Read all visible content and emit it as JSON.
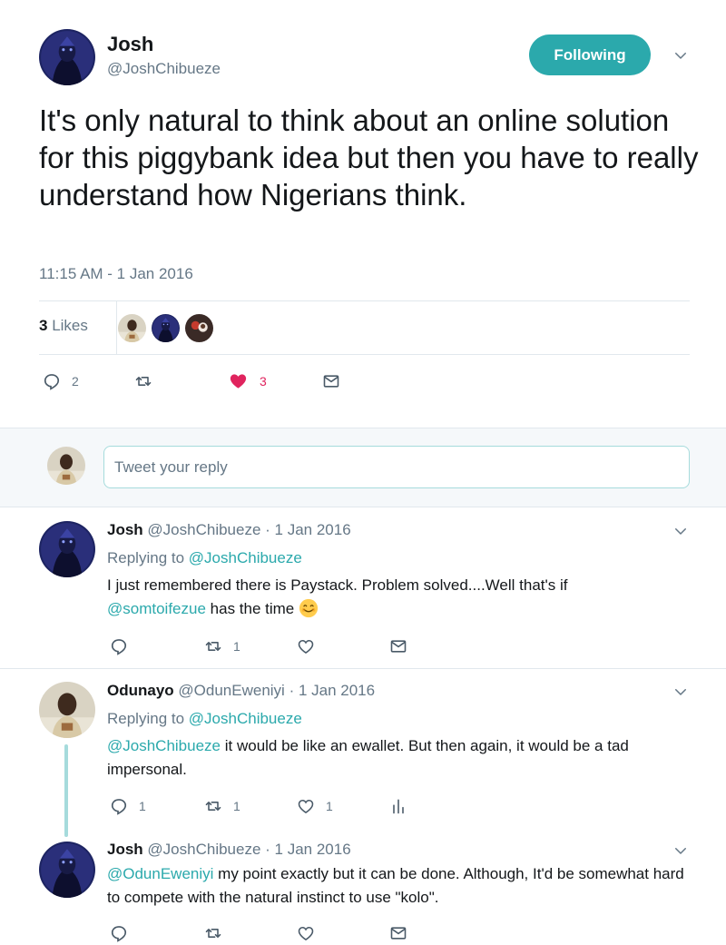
{
  "tweet": {
    "author_name": "Josh",
    "author_handle": "@JoshChibueze",
    "follow_label": "Following",
    "text": "It's only natural to think about an online solution for this piggybank idea but then you have to really understand how Nigerians think.",
    "timestamp": "11:15 AM - 1 Jan 2016",
    "likes_count": "3",
    "likes_label": "Likes",
    "actions": {
      "reply_count": "2",
      "retweet_count": "",
      "like_count": "3"
    }
  },
  "composer": {
    "placeholder": "Tweet your reply"
  },
  "replies": [
    {
      "name": "Josh",
      "handle": "@JoshChibueze",
      "date": "· 1 Jan 2016",
      "replying_label": "Replying to",
      "replying_to": "@JoshChibueze",
      "text_before": "I just remembered there is Paystack. Problem solved....Well that's if",
      "mention": "@somtoifezue",
      "text_after": "has the time",
      "emoji": "smiling-face-emoji",
      "reply_count": "",
      "retweet_count": "1",
      "like_count": ""
    },
    {
      "name": "Odunayo",
      "handle": "@OdunEweniyi",
      "date": "· 1 Jan 2016",
      "replying_label": "Replying to",
      "replying_to": "@JoshChibueze",
      "mention": "@JoshChibueze",
      "text": "it would be like an ewallet. But then again, it would be a tad impersonal.",
      "reply_count": "1",
      "retweet_count": "1",
      "like_count": "1"
    },
    {
      "name": "Josh",
      "handle": "@JoshChibueze",
      "date": "· 1 Jan 2016",
      "mention": "@OdunEweniyi",
      "text": "my point exactly but it can be done. Although, It'd be somewhat hard to compete with the natural instinct to use \"kolo\".",
      "reply_count": "",
      "retweet_count": "",
      "like_count": ""
    }
  ],
  "colors": {
    "accent": "#2ba9ac",
    "like": "#e0245e",
    "muted": "#657786",
    "text": "#14171a"
  }
}
